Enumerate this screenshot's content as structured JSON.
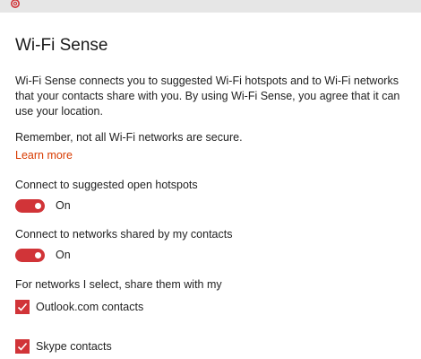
{
  "colors": {
    "accent": "#d13438",
    "link": "#d83b01",
    "text": "#1f1f1f",
    "topbar": "#e6e6e6"
  },
  "header": {
    "icon": "gear-icon"
  },
  "title": "Wi-Fi Sense",
  "description": "Wi-Fi Sense connects you to suggested Wi-Fi hotspots and to Wi-Fi networks that your contacts share with you. By using Wi-Fi Sense, you agree that it can use your location.",
  "remember": "Remember, not all Wi-Fi networks are secure.",
  "learn_more": "Learn more",
  "settings": [
    {
      "label": "Connect to suggested open hotspots",
      "state": "On",
      "on": true
    },
    {
      "label": "Connect to networks shared by my contacts",
      "state": "On",
      "on": true
    }
  ],
  "share": {
    "label": "For networks I select, share them with my",
    "options": [
      {
        "label": "Outlook.com contacts",
        "checked": true
      },
      {
        "label": "Skype contacts",
        "checked": true
      }
    ]
  }
}
